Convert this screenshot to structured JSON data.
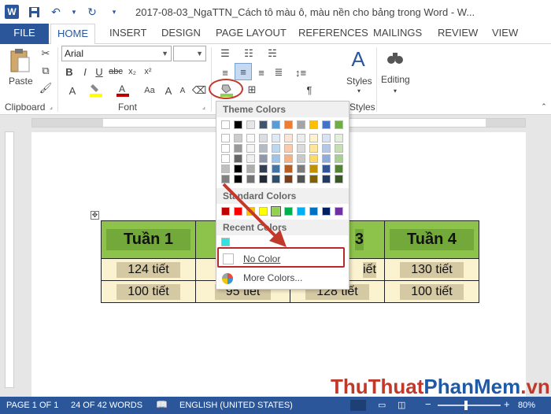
{
  "window": {
    "title": "2017-08-03_NgaTTN_Cách tô màu ô, màu nền cho bảng trong Word - W..."
  },
  "tabs": [
    "FILE",
    "HOME",
    "INSERT",
    "DESIGN",
    "PAGE LAYOUT",
    "REFERENCES",
    "MAILINGS",
    "REVIEW",
    "VIEW"
  ],
  "ribbon": {
    "clipboard": {
      "paste_label": "Paste",
      "group_label": "Clipboard"
    },
    "font": {
      "font_name": "Arial",
      "font_size": "",
      "group_label": "Font"
    },
    "styles": {
      "label": "Styles",
      "group_label": "Styles"
    },
    "editing": {
      "label": "Editing"
    }
  },
  "shading_menu": {
    "theme_header": "Theme Colors",
    "standard_header": "Standard Colors",
    "recent_header": "Recent Colors",
    "no_color": "No Color",
    "more_colors": "More Colors...",
    "theme_top_row": [
      "#ffffff",
      "#000000",
      "#e7e6e6",
      "#44546a",
      "#5b9bd5",
      "#ed7d31",
      "#a5a5a5",
      "#ffc000",
      "#4472c4",
      "#70ad47"
    ],
    "standard_row": [
      "#c00000",
      "#ff0000",
      "#ffc000",
      "#ffff00",
      "#92d050",
      "#00b050",
      "#00b0f0",
      "#0070c0",
      "#002060",
      "#7030a0"
    ],
    "recent_colors": [
      "#33e0e0"
    ]
  },
  "table": {
    "header": [
      "Tuần 1",
      "",
      "3",
      "Tuần 4"
    ],
    "rows": [
      [
        "124 tiết",
        "",
        "iết",
        "130 tiết"
      ],
      [
        "100 tiết",
        "95 tiết",
        "128 tiết",
        "100 tiết"
      ]
    ]
  },
  "status": {
    "page": "PAGE 1 OF 1",
    "words": "24 OF 42 WORDS",
    "language": "ENGLISH (UNITED STATES)",
    "zoom": "80%"
  },
  "watermark": {
    "part1": "ThuThuat",
    "part2": "PhanMem",
    "part3": ".vn"
  }
}
